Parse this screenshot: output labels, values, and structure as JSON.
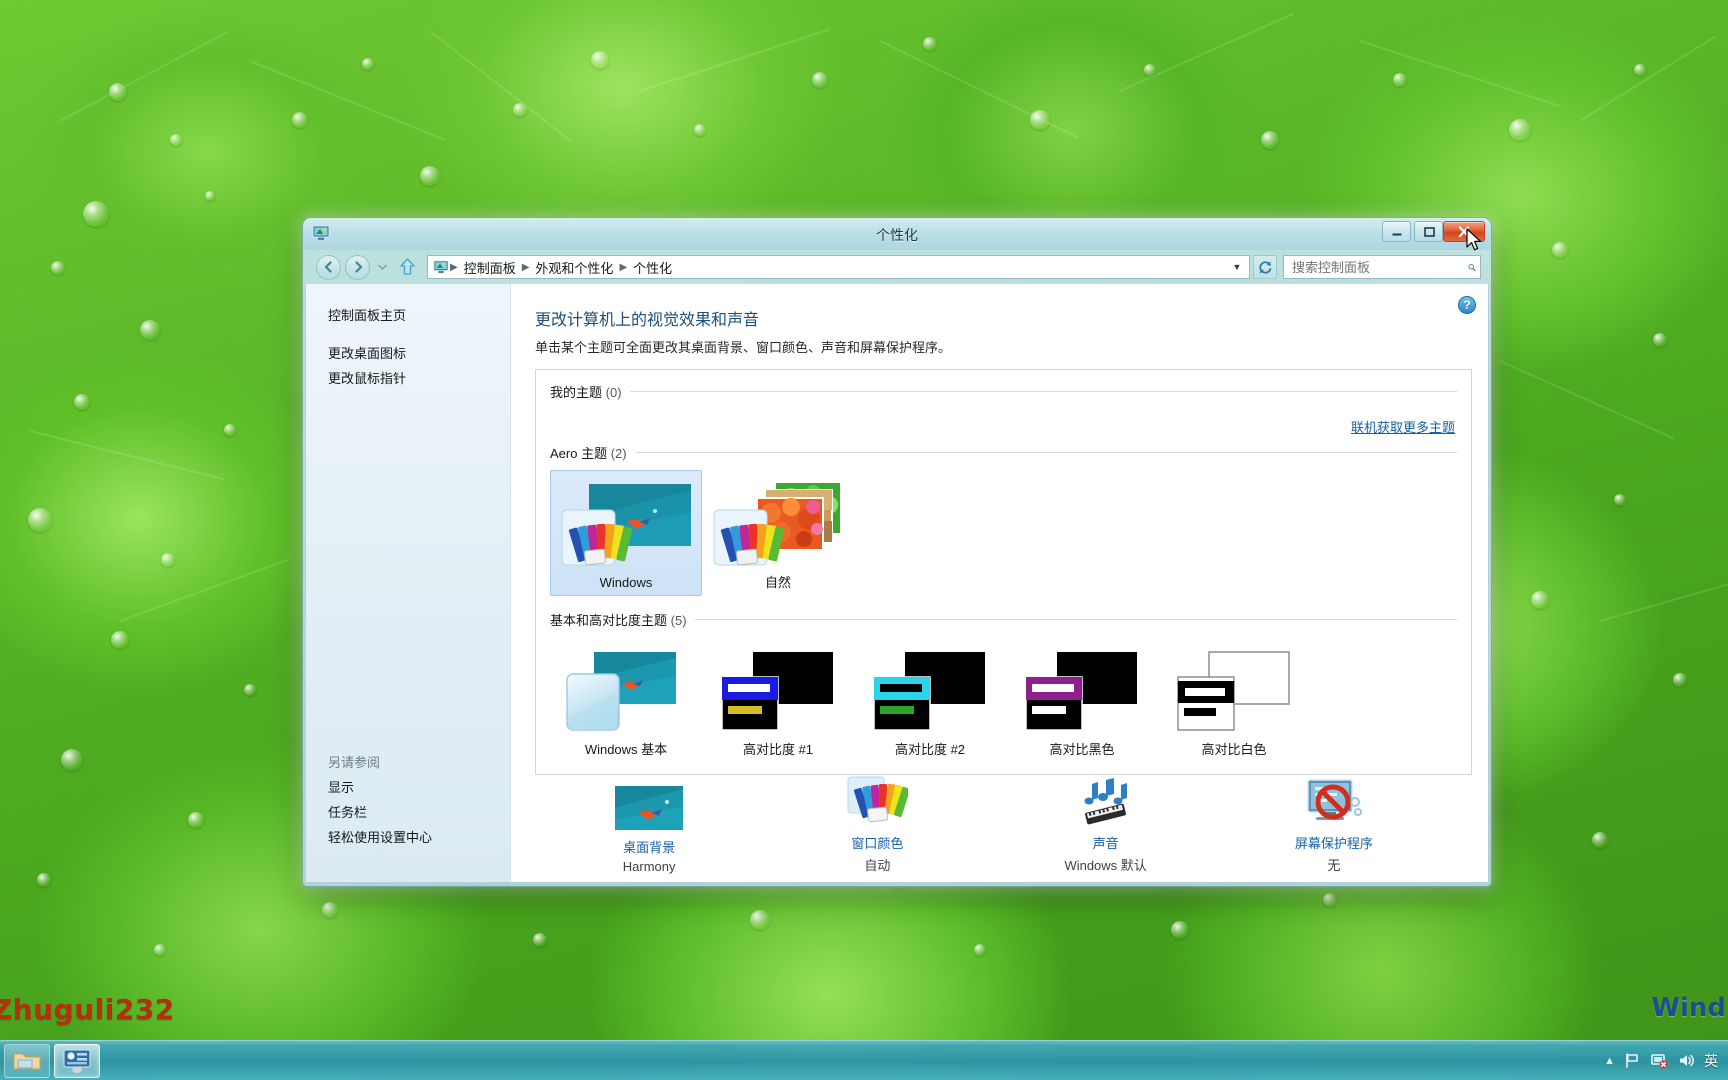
{
  "desktop": {
    "watermark_left": "Zhuguli232",
    "watermark_right": "Wind"
  },
  "window": {
    "title": "个性化",
    "icon_name": "personalization-icon",
    "controls": {
      "minimize": "最小化",
      "maximize": "最大化",
      "close": "关闭"
    }
  },
  "navbar": {
    "back": "后退",
    "forward": "前进",
    "history": "最近浏览的位置",
    "up": "上移到上一级",
    "breadcrumbs": [
      "控制面板",
      "外观和个性化",
      "个性化"
    ],
    "dropdown": "▼",
    "refresh": "刷新",
    "search": {
      "placeholder": "搜索控制面板",
      "value": "",
      "icon": "search-icon"
    }
  },
  "sidebar": {
    "home": "控制面板主页",
    "links": [
      "更改桌面图标",
      "更改鼠标指针"
    ],
    "see_also_heading": "另请参阅",
    "see_also": [
      "显示",
      "任务栏",
      "轻松使用设置中心"
    ]
  },
  "content": {
    "help": "?",
    "page_title": "更改计算机上的视觉效果和声音",
    "page_subtitle": "单击某个主题可全面更改其桌面背景、窗口颜色、声音和屏幕保护程序。",
    "online_themes_link": "联机获取更多主题",
    "groups": [
      {
        "label": "我的主题",
        "count": "(0)"
      },
      {
        "label": "Aero 主题",
        "count": "(2)"
      },
      {
        "label": "基本和高对比度主题",
        "count": "(5)"
      }
    ],
    "aero_themes": [
      {
        "name": "Windows",
        "selected": true
      },
      {
        "name": "自然",
        "selected": false
      }
    ],
    "basic_themes": [
      {
        "name": "Windows 基本"
      },
      {
        "name": "高对比度 #1"
      },
      {
        "name": "高对比度 #2"
      },
      {
        "name": "高对比黑色"
      },
      {
        "name": "高对比白色"
      }
    ],
    "settings": [
      {
        "icon": "desktop-background-icon",
        "label": "桌面背景",
        "value": "Harmony"
      },
      {
        "icon": "window-color-icon",
        "label": "窗口颜色",
        "value": "自动"
      },
      {
        "icon": "sound-icon",
        "label": "声音",
        "value": "Windows 默认"
      },
      {
        "icon": "screensaver-icon",
        "label": "屏幕保护程序",
        "value": "无"
      }
    ]
  },
  "taskbar": {
    "buttons": [
      {
        "name": "explorer-taskbar-button",
        "active": false
      },
      {
        "name": "control-panel-taskbar-button",
        "active": true
      }
    ],
    "tray": {
      "show_hidden": "▲",
      "action_center": "operations-flag-icon",
      "network": "network-icon",
      "volume": "volume-icon",
      "language": "英"
    }
  },
  "colors": {
    "accent_link": "#1560a8",
    "title_blue": "#1d4f7c",
    "close_red": "#d3451c",
    "selection_blue": "#cde2f8"
  }
}
